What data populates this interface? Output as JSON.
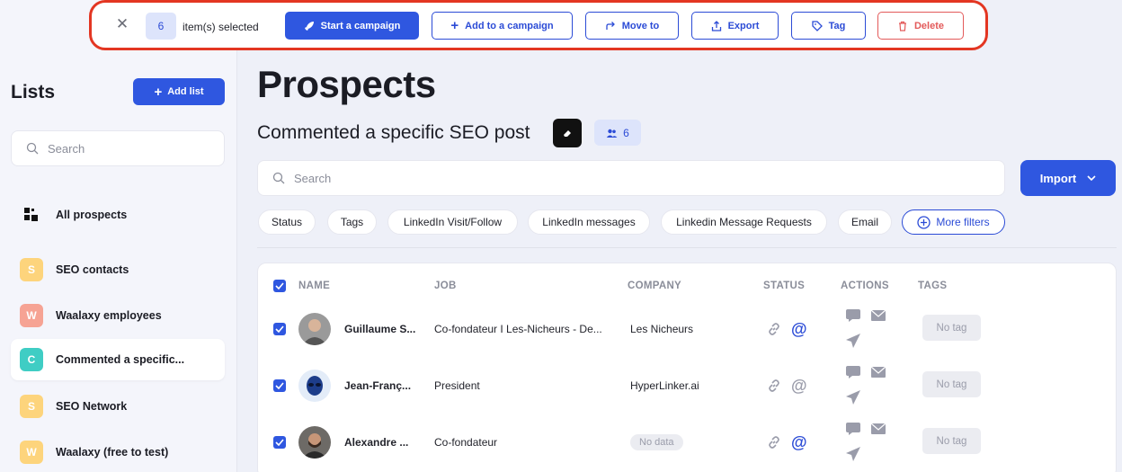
{
  "selection_bar": {
    "count": "6",
    "label": "item(s) selected",
    "buttons": {
      "start_campaign": "Start a campaign",
      "add_campaign": "Add to a campaign",
      "move_to": "Move to",
      "export": "Export",
      "tag": "Tag",
      "delete": "Delete"
    }
  },
  "sidebar": {
    "title": "Lists",
    "add_list": "Add list",
    "search_placeholder": "Search",
    "all_prospects": "All prospects",
    "items": [
      {
        "badge": "S",
        "label": "SEO contacts",
        "color": "#fdd47c"
      },
      {
        "badge": "W",
        "label": "Waalaxy employees",
        "color": "#f6a394"
      },
      {
        "badge": "C",
        "label": "Commented a specific...",
        "color": "#3fcdc4"
      },
      {
        "badge": "S",
        "label": "SEO Network",
        "color": "#fdd47c"
      },
      {
        "badge": "W",
        "label": "Waalaxy (free to test)",
        "color": "#fdd47c"
      }
    ]
  },
  "main": {
    "title": "Prospects",
    "list_title": "Commented a specific SEO post",
    "prospect_count": "6",
    "search_placeholder": "Search",
    "import": "Import",
    "filters": [
      "Status",
      "Tags",
      "LinkedIn Visit/Follow",
      "LinkedIn messages",
      "Linkedin Message Requests",
      "Email"
    ],
    "more_filters": "More filters"
  },
  "table": {
    "columns": [
      "NAME",
      "JOB",
      "COMPANY",
      "STATUS",
      "ACTIONS",
      "TAGS"
    ],
    "rows": [
      {
        "name": "Guillaume S...",
        "job": "Co-fondateur I Les-Nicheurs - De...",
        "company": "Les Nicheurs",
        "no_tag": "No tag",
        "email_active": true
      },
      {
        "name": "Jean-Franç...",
        "job": "President",
        "company": "HyperLinker.ai",
        "no_tag": "No tag",
        "email_active": false
      },
      {
        "name": "Alexandre ...",
        "job": "Co-fondateur",
        "company": "No data",
        "no_tag": "No tag",
        "email_active": true
      }
    ]
  },
  "colors": {
    "accent": "#2f57e0",
    "highlight_border": "#e33622",
    "danger": "#e35a5a"
  }
}
